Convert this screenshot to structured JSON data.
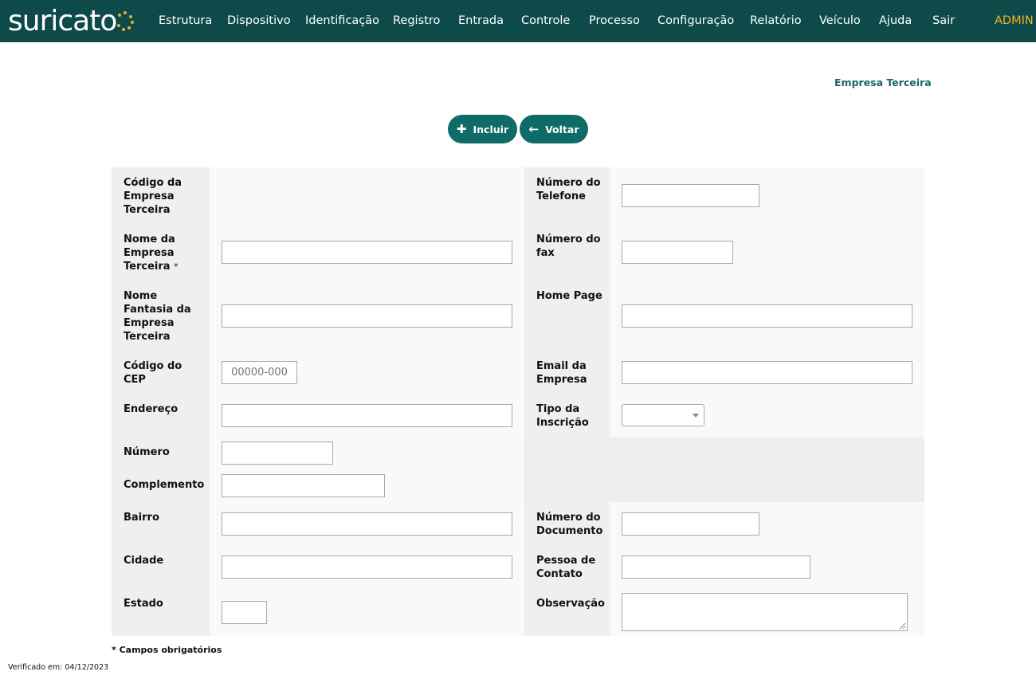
{
  "app": {
    "logo_text": "suricato"
  },
  "nav": {
    "items": [
      "Estrutura",
      "Dispositivo",
      "Identificação",
      "Registro",
      "Entrada",
      "Controle",
      "Processo",
      "Configuração",
      "Relatório",
      "Veículo",
      "Ajuda",
      "Sair"
    ],
    "user": "ADMIN"
  },
  "page": {
    "title": "Empresa Terceira"
  },
  "actions": {
    "include_label": "Incluir",
    "back_label": "Voltar"
  },
  "form": {
    "left": {
      "codigo_label": "Código da Empresa Terceira",
      "nome_label": "Nome da Empresa Terceira",
      "nome_required": "*",
      "fantasia_label": "Nome Fantasia da Empresa Terceira",
      "cep_label": "Código do CEP",
      "cep_placeholder": "00000-000",
      "endereco_label": "Endereço",
      "numero_label": "Número",
      "complemento_label": "Complemento",
      "bairro_label": "Bairro",
      "cidade_label": "Cidade",
      "estado_label": "Estado"
    },
    "right": {
      "telefone_label": "Número do Telefone",
      "fax_label": "Número do fax",
      "homepage_label": "Home Page",
      "email_label": "Email da Empresa",
      "tipo_label": "Tipo da Inscrição",
      "tipo_value": "",
      "documento_label": "Número do Documento",
      "contato_label": "Pessoa de Contato",
      "observacao_label": "Observação"
    }
  },
  "footer": {
    "required_note": "* Campos obrigatórios",
    "verified": "Verificado em: 04/12/2023"
  },
  "colors": {
    "topbar": "#0e4a4a",
    "accent": "#0f6b68",
    "admin": "#f0b42a",
    "title": "#1a6565"
  }
}
